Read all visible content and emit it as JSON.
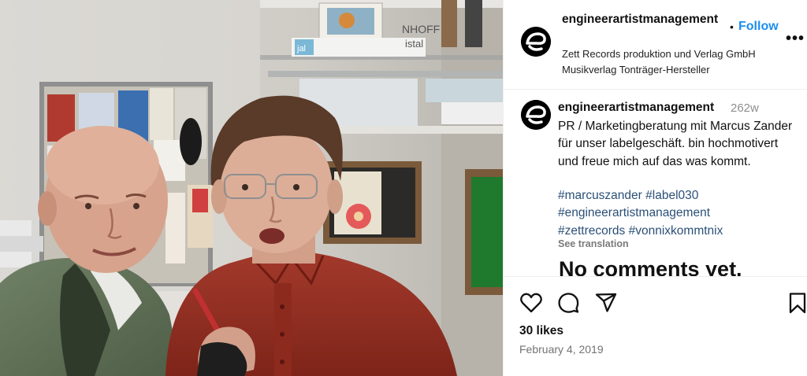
{
  "header": {
    "username": "engineerartistmanagement",
    "separator": "•",
    "follow_label": "Follow",
    "more_label": "•••",
    "subtitle": "Zett Records produktion und Verlag GmbH Musikverlag Tonträger-Hersteller"
  },
  "caption": {
    "username": "engineerartistmanagement",
    "time": "262w",
    "text": "PR / Marketingberatung mit Marcus Zander für unser labelgeschäft. bin hochmotivert und freue mich auf das was kommt.",
    "hashtags": [
      "#marcuszander",
      "#label030",
      "#engineerartistmanagement",
      "#zettrecords",
      "#vonnixkommtnix"
    ],
    "see_translation": "See translation"
  },
  "comments": {
    "empty_text": "No comments yet."
  },
  "actions": {
    "icons": [
      "heart-icon",
      "comment-icon",
      "share-icon",
      "bookmark-icon"
    ],
    "likes": "30 likes",
    "date": "February 4, 2019"
  },
  "photo": {
    "shelf_label_1": "NHOFF",
    "shelf_label_2": "istal",
    "box_label": "jal"
  }
}
